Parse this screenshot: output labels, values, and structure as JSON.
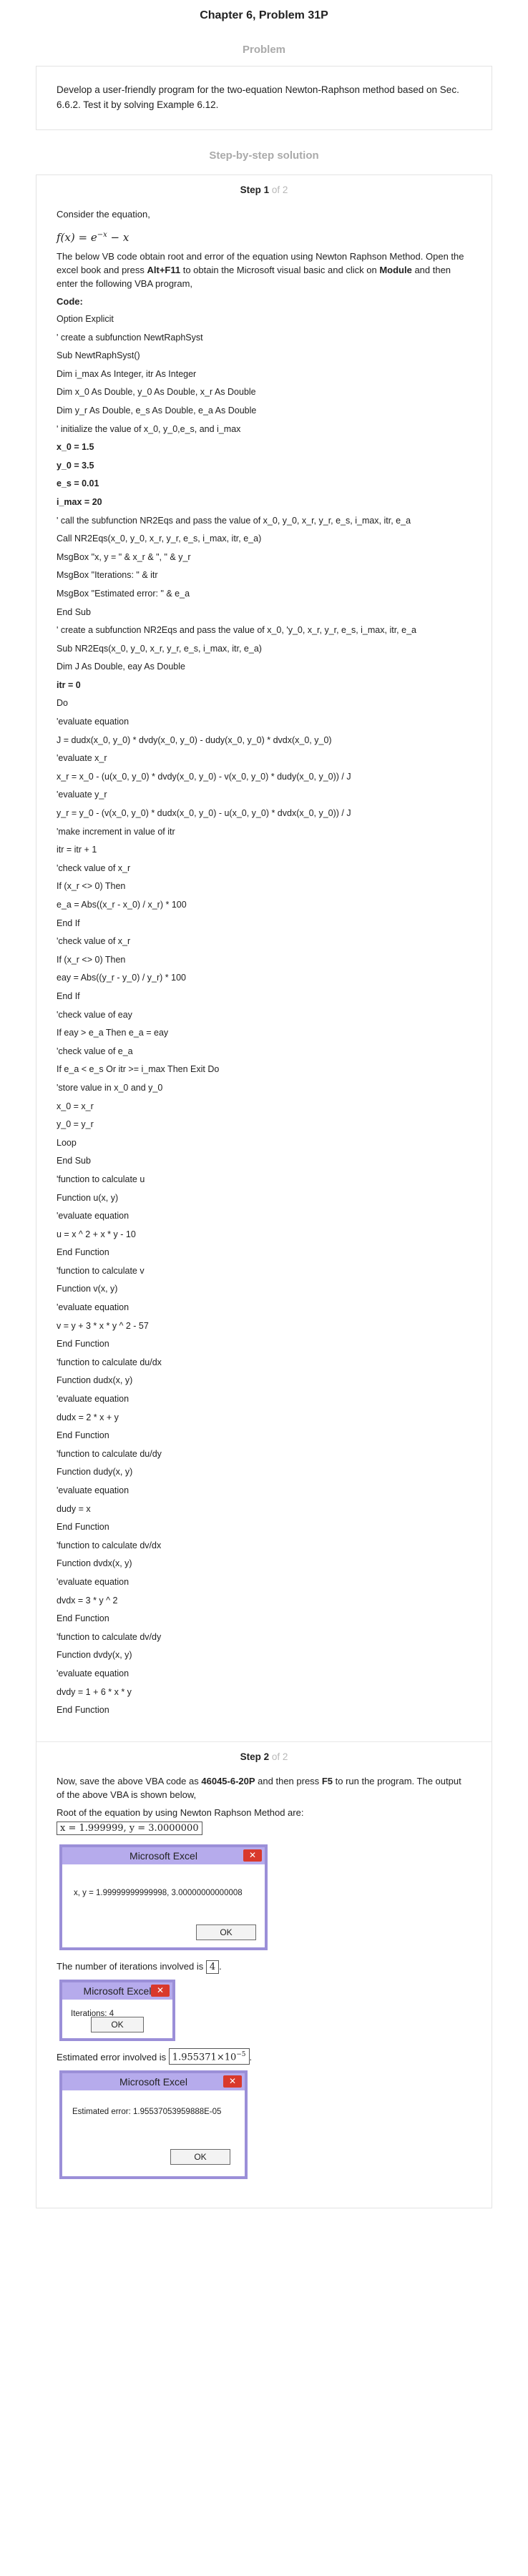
{
  "header": {
    "title": "Chapter 6, Problem 31P"
  },
  "problem_label": "Problem",
  "problem_text": "Develop a user-friendly program for the two-equation Newton-Raphson method based on Sec. 6.6.2. Test it by solving Example 6.12.",
  "solution_label": "Step-by-step solution",
  "step1": {
    "label": "Step 1",
    "of": "of 2",
    "intro": "Consider the equation,",
    "formula_lhs": "f(x) = e",
    "formula_sup": "−x",
    "formula_rhs": " − x",
    "para1": "The below VB code obtain root and error of the equation using Newton Raphson Method. Open the excel book and press",
    "para1_key": "Alt+F11",
    "para1_mid": "to obtain the Microsoft visual basic and click on",
    "para1_module": "Module",
    "para1_end": "and then enter the following VBA program,",
    "code_label": "Code:",
    "code": [
      "Option Explicit",
      "' create a subfunction NewtRaphSyst",
      "Sub NewtRaphSyst()",
      "Dim i_max As Integer, itr As Integer",
      "Dim x_0 As Double, y_0 As Double, x_r As Double",
      "Dim y_r As Double, e_s As Double, e_a As Double",
      "' initialize the value of x_0, y_0,e_s, and i_max",
      "x_0 = 1.5",
      "y_0 = 3.5",
      "e_s = 0.01",
      "i_max = 20",
      "' call the subfunction NR2Eqs and pass the value of x_0, y_0, x_r, y_r, e_s, i_max, itr, e_a",
      "Call NR2Eqs(x_0, y_0, x_r, y_r, e_s, i_max, itr, e_a)",
      "MsgBox \"x, y = \" & x_r & \", \" & y_r",
      "MsgBox \"Iterations: \" & itr",
      "MsgBox \"Estimated error: \" & e_a",
      "End Sub",
      "' create a subfunction NR2Eqs and pass the value of x_0, 'y_0, x_r, y_r, e_s, i_max, itr, e_a",
      "Sub NR2Eqs(x_0, y_0, x_r, y_r, e_s, i_max, itr, e_a)",
      "Dim J As Double, eay As Double",
      "itr = 0",
      "Do",
      "'evaluate equation",
      "J = dudx(x_0, y_0) * dvdy(x_0, y_0) - dudy(x_0, y_0) * dvdx(x_0, y_0)",
      "'evaluate x_r",
      "x_r = x_0 - (u(x_0, y_0) * dvdy(x_0, y_0) - v(x_0, y_0) * dudy(x_0, y_0)) / J",
      "'evaluate y_r",
      "y_r = y_0 - (v(x_0, y_0) * dudx(x_0, y_0) - u(x_0, y_0) * dvdx(x_0, y_0)) / J",
      "'make increment in value of itr",
      "itr = itr + 1",
      "'check value of x_r",
      "If (x_r <> 0) Then",
      "e_a = Abs((x_r - x_0) / x_r) * 100",
      "End If",
      "'check value of x_r",
      "If (x_r <> 0) Then",
      "eay = Abs((y_r - y_0) / y_r) * 100",
      "End If",
      "'check value of eay",
      "If eay > e_a Then e_a = eay",
      "'check value of e_a",
      "If e_a < e_s Or itr >= i_max Then Exit Do",
      "'store value in x_0 and y_0",
      "x_0 = x_r",
      "y_0 = y_r",
      "Loop",
      "End Sub",
      "'function to calculate u",
      "Function u(x, y)",
      "'evaluate equation",
      "u = x ^ 2 + x * y - 10",
      "End Function",
      "'function to calculate v",
      "Function v(x, y)",
      "'evaluate equation",
      "v = y + 3 * x * y ^ 2 - 57",
      "End Function",
      "'function to calculate du/dx",
      "Function dudx(x, y)",
      "'evaluate equation",
      "dudx = 2 * x + y",
      "End Function",
      "'function to calculate du/dy",
      "Function dudy(x, y)",
      "'evaluate equation",
      "dudy = x",
      "End Function",
      "'function to calculate dv/dx",
      "Function dvdx(x, y)",
      "'evaluate equation",
      "dvdx = 3 * y ^ 2",
      "End Function",
      "'function to calculate dv/dy",
      "Function dvdy(x, y)",
      "'evaluate equation",
      "dvdy = 1 + 6 * x * y",
      "End Function"
    ]
  },
  "step2": {
    "label": "Step 2",
    "of": "of 2",
    "para1": "Now, save the above VBA code as",
    "para1_name": "46045-6-20P",
    "para1_mid": "and then press",
    "para1_key": "F5",
    "para1_end": "to run the program. The output of the above VBA is shown below,",
    "root_text": "Root of the equation by using Newton Raphson Method are:",
    "root_box": "x = 1.999999, y = 3.0000000",
    "dialog_title": "Microsoft Excel",
    "dialog_ok": "OK",
    "dialog1_msg": "x, y = 1.99999999999998, 3.00000000000008",
    "iter_text": "The number of iterations involved is",
    "iter_box": "4",
    "dialog2_msg": "Iterations: 4",
    "error_text": "Estimated error involved is",
    "error_box": "1.955371×10",
    "error_box_sup": "−5",
    "dialog3_msg": "Estimated error: 1.95537053959888E-05"
  }
}
